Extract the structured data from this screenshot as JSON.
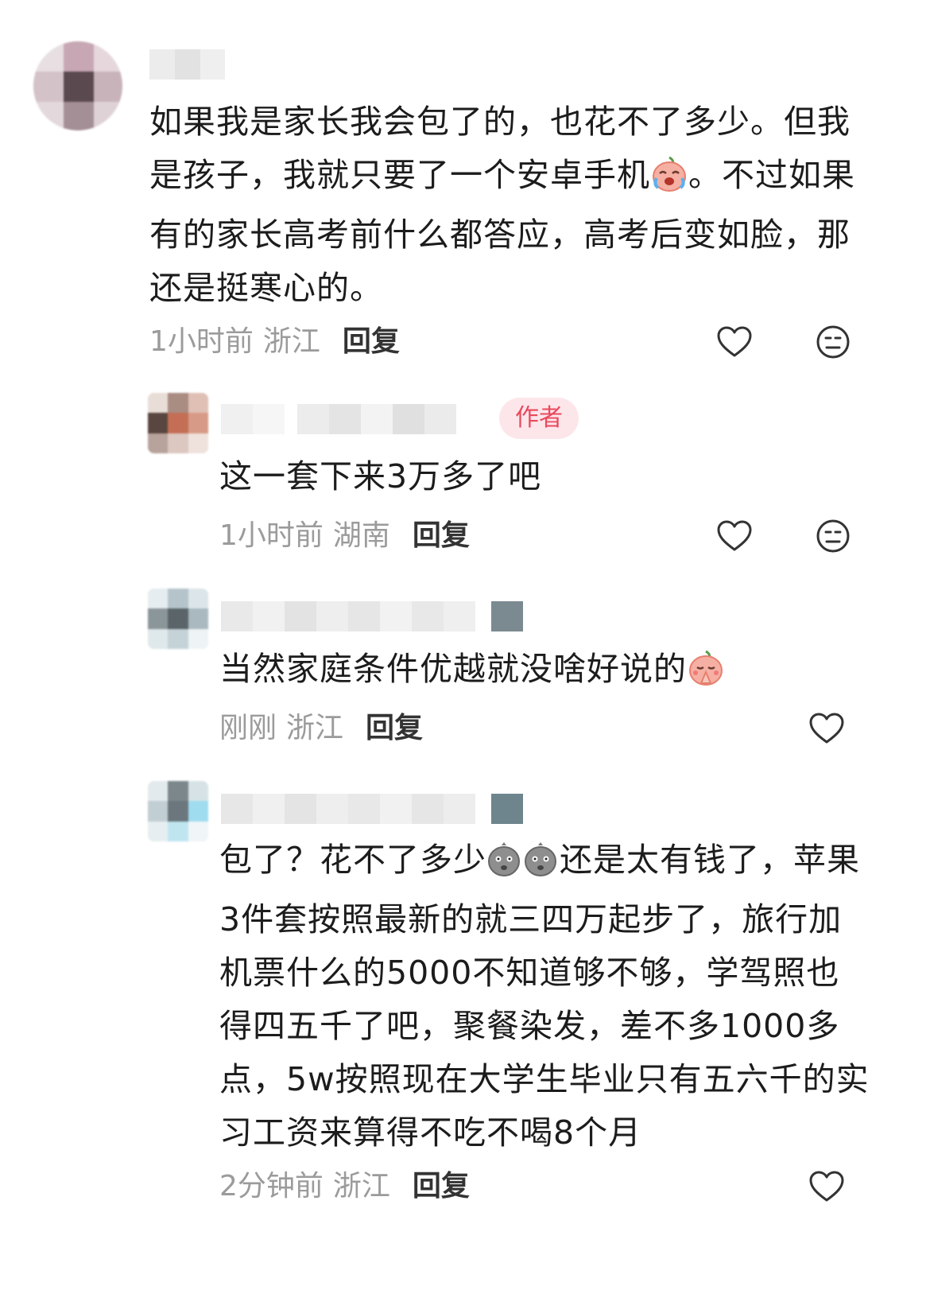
{
  "comments": [
    {
      "text_a": "如果我是家长我会包了的，也花不了多少。但我是孩子，我就只要了一个安卓手机",
      "emoji_a": "laugh-cry-peach-emoji",
      "text_b": "。不过如果有的家长高考前什么都答应，高考后变如脸，那还是挺寒心的。",
      "time": "1小时前",
      "location": "浙江",
      "reply_label": "回复"
    },
    {
      "badge": "作者",
      "text": "这一套下来3万多了吧",
      "time": "1小时前",
      "location": "湖南",
      "reply_label": "回复"
    },
    {
      "text": "当然家庭条件优越就没啥好说的",
      "emoji": "praying-peach-emoji",
      "time": "刚刚",
      "location": "浙江",
      "reply_label": "回复"
    },
    {
      "text_a": "包了？花不了多少",
      "emoji_a": "gray-speechless-emoji",
      "text_b": "还是太有钱了，苹果3件套按照最新的就三四万起步了，旅行加机票什么的5000不知道够不够，学驾照也得四五千了吧，聚餐染发，差不多1000多点，5w按照现在大学生毕业只有五六千的实习工资来算得不吃不喝8个月",
      "time": "2分钟前",
      "location": "浙江",
      "reply_label": "回复"
    }
  ],
  "colors": {
    "badge_bg": "#fde6ea",
    "badge_text": "#e9495d",
    "meta_text": "#9b9b9b"
  }
}
